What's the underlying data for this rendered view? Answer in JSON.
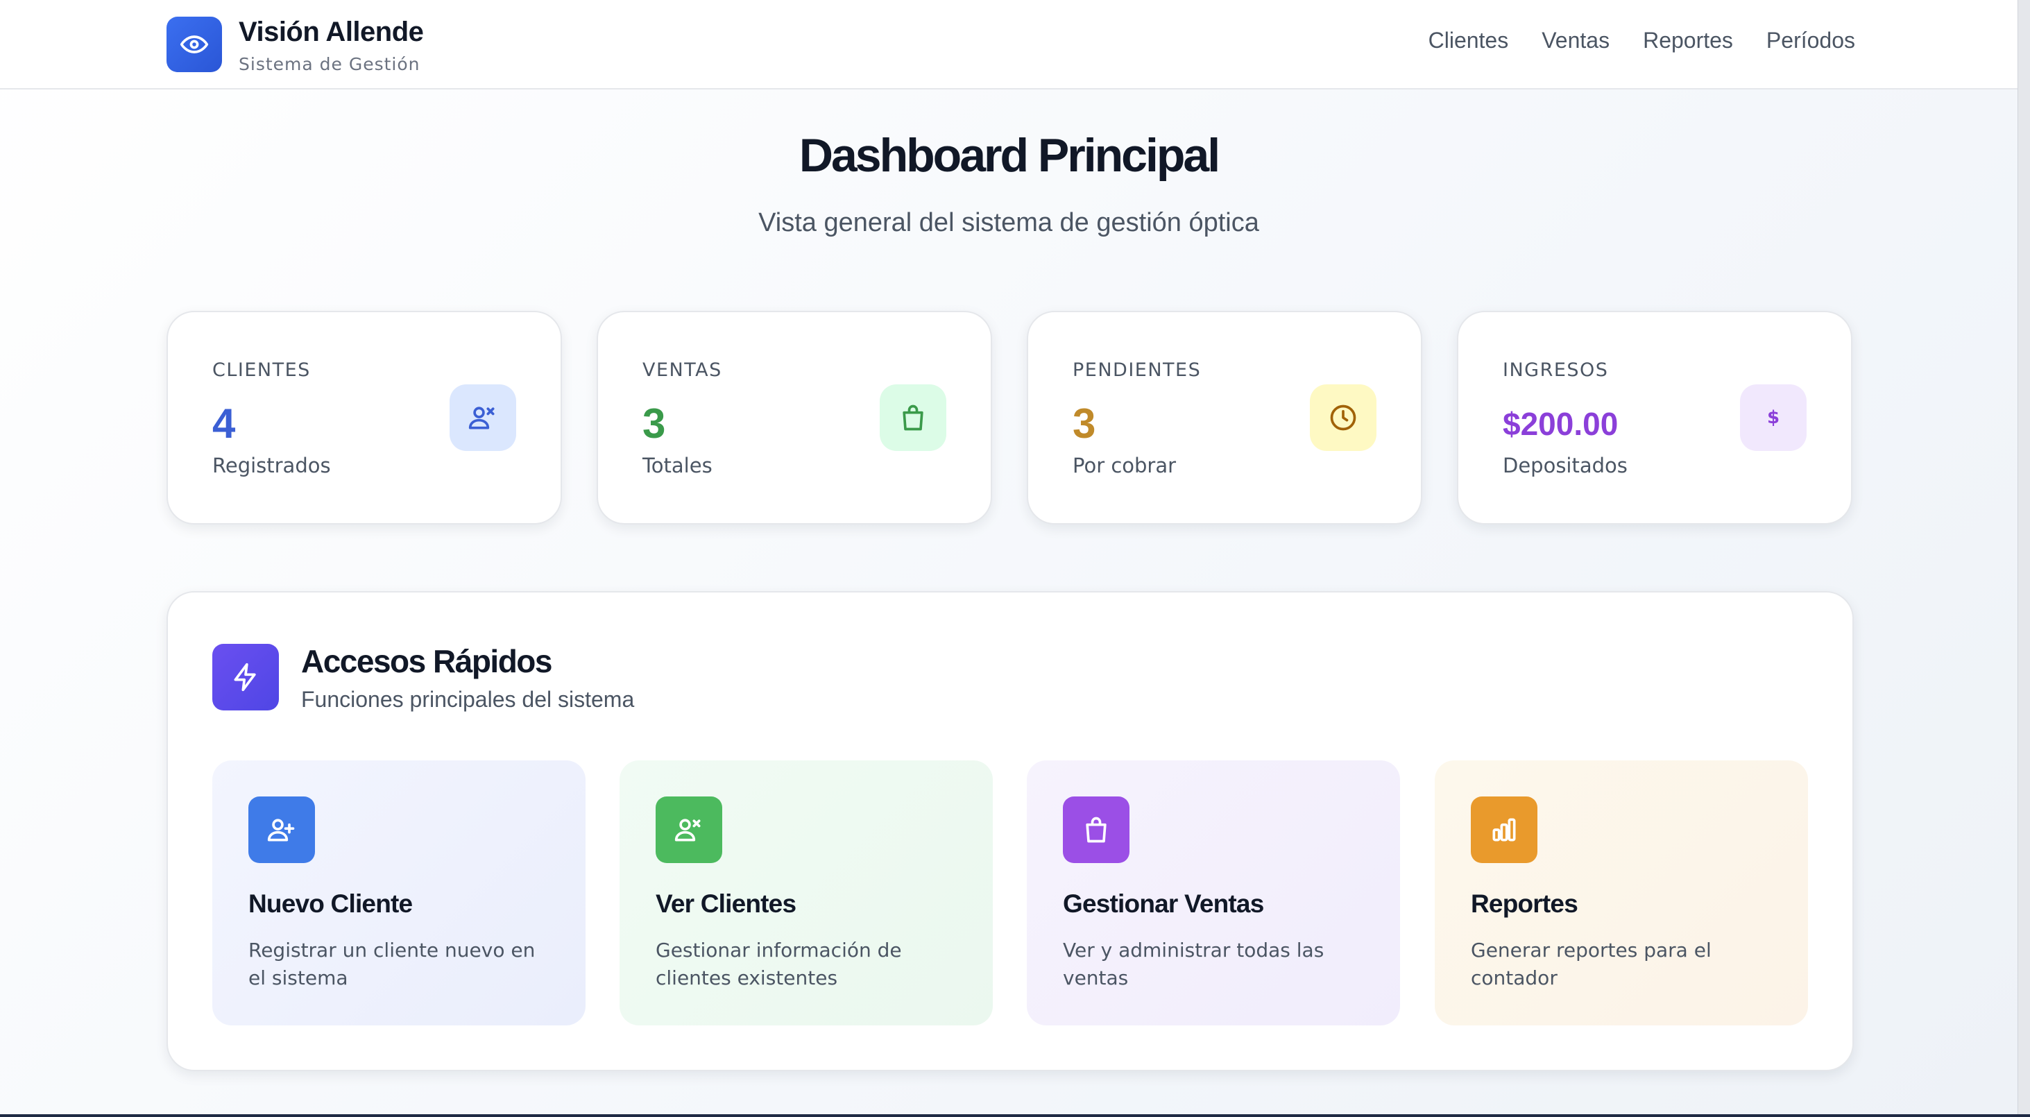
{
  "header": {
    "brand_title": "Visión Allende",
    "brand_subtitle": "Sistema de Gestión",
    "nav": [
      "Clientes",
      "Ventas",
      "Reportes",
      "Períodos"
    ]
  },
  "main": {
    "title": "Dashboard Principal",
    "subtitle": "Vista general del sistema de gestión óptica"
  },
  "stats": [
    {
      "label": "CLIENTES",
      "value": "4",
      "caption": "Registrados",
      "color": "#3b5fd4",
      "icon": "users-icon",
      "icon_bg": "#dbe7fe"
    },
    {
      "label": "VENTAS",
      "value": "3",
      "caption": "Totales",
      "color": "#3a9a4a",
      "icon": "shopping-bag-icon",
      "icon_bg": "#dcfce7"
    },
    {
      "label": "PENDIENTES",
      "value": "3",
      "caption": "Por cobrar",
      "color": "#c08a2a",
      "icon": "clock-icon",
      "icon_bg": "#fef9c3"
    },
    {
      "label": "INGRESOS",
      "value": "$200.00",
      "caption": "Depositados",
      "color": "#8b3fd9",
      "icon": "dollar-icon",
      "icon_bg": "#f1e8fd"
    }
  ],
  "quick_access": {
    "title": "Accesos Rápidos",
    "subtitle": "Funciones principales del sistema",
    "items": [
      {
        "title": "Nuevo Cliente",
        "description": "Registrar un cliente nuevo en el sistema",
        "icon": "user-plus-icon",
        "color": "#3f7be8",
        "bg": "#eef2fd"
      },
      {
        "title": "Ver Clientes",
        "description": "Gestionar información de clientes existentes",
        "icon": "users-icon",
        "color": "#4cba5e",
        "bg": "#effbf2"
      },
      {
        "title": "Gestionar Ventas",
        "description": "Ver y administrar todas las ventas",
        "icon": "shopping-bag-icon",
        "color": "#9b4fe6",
        "bg": "#f5f1fd"
      },
      {
        "title": "Reportes",
        "description": "Generar reportes para el contador",
        "icon": "bar-chart-icon",
        "color": "#e99a2c",
        "bg": "#fdf7ea"
      }
    ]
  }
}
